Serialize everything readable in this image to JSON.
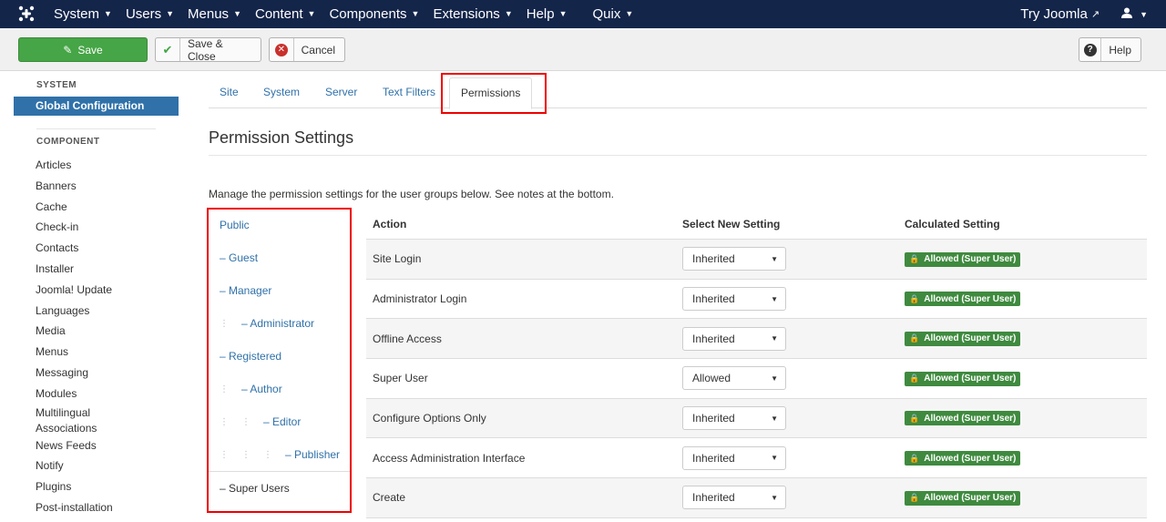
{
  "navbar": {
    "items": [
      {
        "label": "System"
      },
      {
        "label": "Users"
      },
      {
        "label": "Menus"
      },
      {
        "label": "Content"
      },
      {
        "label": "Components"
      },
      {
        "label": "Extensions"
      },
      {
        "label": "Help"
      },
      {
        "label": "Quix"
      }
    ],
    "try_joomla": "Try Joomla"
  },
  "toolbar": {
    "save": "Save",
    "save_close": "Save & Close",
    "cancel": "Cancel",
    "help": "Help"
  },
  "sidebar": {
    "system_header": "SYSTEM",
    "active_item": "Global Configuration",
    "component_header": "COMPONENT",
    "items": [
      "Articles",
      "Banners",
      "Cache",
      "Check-in",
      "Contacts",
      "Installer",
      "Joomla! Update",
      "Languages",
      "Media",
      "Menus",
      "Messaging",
      "Modules",
      "Multilingual Associations",
      "News Feeds",
      "Notify",
      "Plugins",
      "Post-installation"
    ]
  },
  "tabs": [
    "Site",
    "System",
    "Server",
    "Text Filters",
    "Permissions"
  ],
  "active_tab": "Permissions",
  "main": {
    "title": "Permission Settings",
    "description": "Manage the permission settings for the user groups below. See notes at the bottom."
  },
  "groups": [
    {
      "label": "Public",
      "depth": 0
    },
    {
      "label": "– Guest",
      "depth": 0
    },
    {
      "label": "– Manager",
      "depth": 0
    },
    {
      "label": "– Administrator",
      "depth": 1
    },
    {
      "label": "– Registered",
      "depth": 0
    },
    {
      "label": "– Author",
      "depth": 1
    },
    {
      "label": "– Editor",
      "depth": 2
    },
    {
      "label": "– Publisher",
      "depth": 3
    },
    {
      "label": "– Super Users",
      "depth": 0
    }
  ],
  "table": {
    "headers": {
      "action": "Action",
      "select": "Select New Setting",
      "calc": "Calculated Setting"
    },
    "rows": [
      {
        "action": "Site Login",
        "setting": "Inherited",
        "calculated": "Allowed (Super User)"
      },
      {
        "action": "Administrator Login",
        "setting": "Inherited",
        "calculated": "Allowed (Super User)"
      },
      {
        "action": "Offline Access",
        "setting": "Inherited",
        "calculated": "Allowed (Super User)"
      },
      {
        "action": "Super User",
        "setting": "Allowed",
        "calculated": "Allowed (Super User)"
      },
      {
        "action": "Configure Options Only",
        "setting": "Inherited",
        "calculated": "Allowed (Super User)"
      },
      {
        "action": "Access Administration Interface",
        "setting": "Inherited",
        "calculated": "Allowed (Super User)"
      },
      {
        "action": "Create",
        "setting": "Inherited",
        "calculated": "Allowed (Super User)"
      }
    ]
  },
  "colors": {
    "navbar": "#14254a",
    "save_green": "#46a546",
    "link_blue": "#3071a9",
    "highlight_red": "#ee0000",
    "badge_green": "#3f8a3f"
  }
}
